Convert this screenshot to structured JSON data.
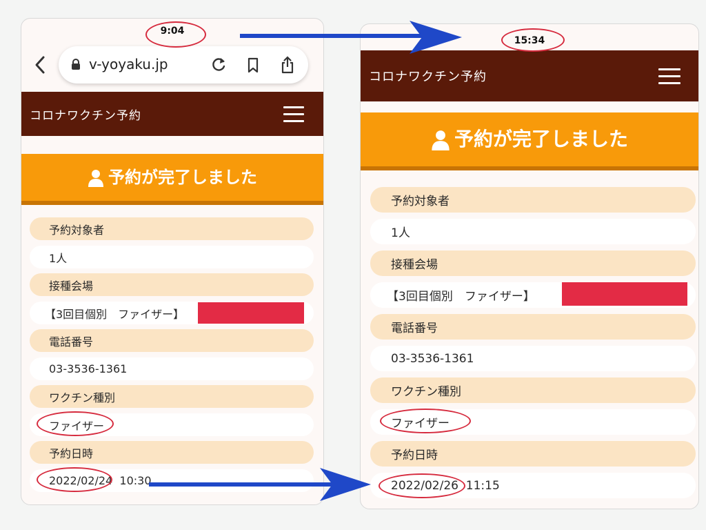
{
  "left": {
    "time": "9:04",
    "browser": {
      "url": "v-yoyaku.jp"
    },
    "app_title": "コロナワクチン予約",
    "banner": "予約が完了しました",
    "rows": [
      {
        "kind": "label",
        "text": "予約対象者"
      },
      {
        "kind": "value",
        "text": "1人"
      },
      {
        "kind": "label",
        "text": "接種会場"
      },
      {
        "kind": "value",
        "text": "【3回目個別　ファイザー】"
      },
      {
        "kind": "label",
        "text": "電話番号"
      },
      {
        "kind": "value",
        "text": "03-3536-1361"
      },
      {
        "kind": "label",
        "text": "ワクチン種別"
      },
      {
        "kind": "value",
        "text": "ファイザー"
      },
      {
        "kind": "label",
        "text": "予約日時"
      },
      {
        "kind": "value",
        "text": "2022/02/24  10:30"
      }
    ]
  },
  "right": {
    "time": "15:34",
    "app_title": "コロナワクチン予約",
    "banner": "予約が完了しました",
    "rows": [
      {
        "kind": "label",
        "text": "予約対象者"
      },
      {
        "kind": "value",
        "text": "1人"
      },
      {
        "kind": "label",
        "text": "接種会場"
      },
      {
        "kind": "value",
        "text": "【3回目個別　ファイザー】"
      },
      {
        "kind": "label",
        "text": "電話番号"
      },
      {
        "kind": "value",
        "text": "03-3536-1361"
      },
      {
        "kind": "label",
        "text": "ワクチン種別"
      },
      {
        "kind": "value",
        "text": "ファイザー"
      },
      {
        "kind": "label",
        "text": "予約日時"
      },
      {
        "kind": "value",
        "text": "2022/02/26  11:15"
      }
    ]
  },
  "colors": {
    "header": "#5a1a09",
    "banner": "#f89a0a",
    "label_row": "#fbe4c4",
    "redaction": "#e32b45",
    "annotation_ellipse": "#d62b3e",
    "annotation_arrow": "#1f48c8"
  }
}
